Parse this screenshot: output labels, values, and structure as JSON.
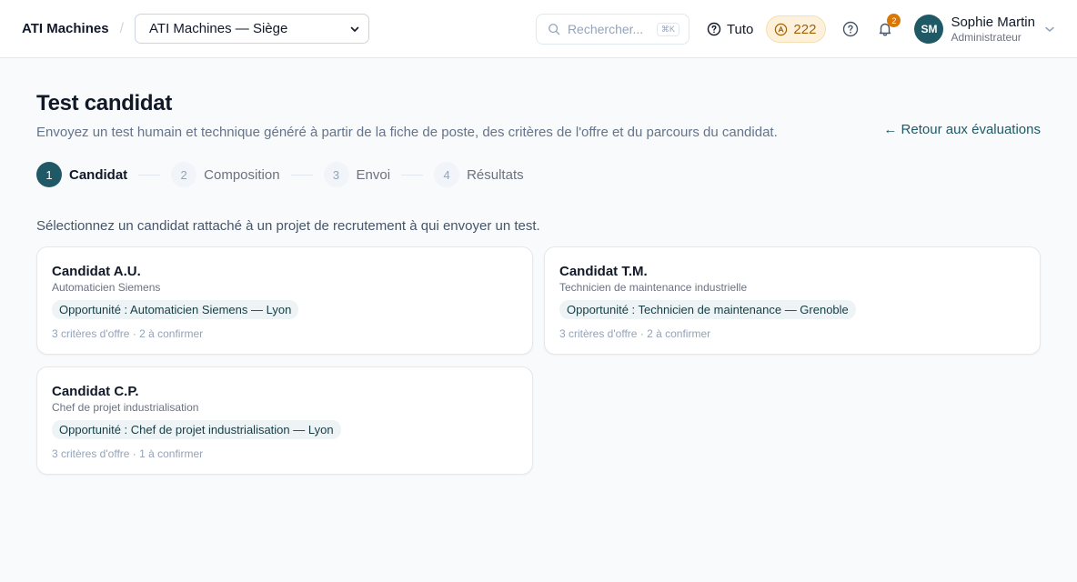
{
  "header": {
    "brand": "ATI Machines",
    "separator": "/",
    "org_select": "ATI Machines — Siège",
    "search_placeholder": "Rechercher...",
    "search_shortcut": "⌘K",
    "tuto_label": "Tuto",
    "credits": "222",
    "notifications_count": "2",
    "user": {
      "initials": "SM",
      "name": "Sophie Martin",
      "role": "Administrateur"
    }
  },
  "page": {
    "title": "Test candidat",
    "subtitle": "Envoyez un test humain et technique généré à partir de la fiche de poste, des critères de l'offre et du parcours du candidat.",
    "back_link": "← Retour aux évaluations"
  },
  "steps": [
    {
      "num": "1",
      "label": "Candidat"
    },
    {
      "num": "2",
      "label": "Composition"
    },
    {
      "num": "3",
      "label": "Envoi"
    },
    {
      "num": "4",
      "label": "Résultats"
    }
  ],
  "active_step": "1",
  "instruction": "Sélectionnez un candidat rattaché à un projet de recrutement à qui envoyer un test.",
  "candidates": [
    {
      "name": "Candidat A.U.",
      "role": "Automaticien Siemens",
      "opportunity": "Opportunité : Automaticien Siemens — Lyon",
      "meta": "3 critères d'offre · 2 à confirmer"
    },
    {
      "name": "Candidat T.M.",
      "role": "Technicien de maintenance industrielle",
      "opportunity": "Opportunité : Technicien de maintenance — Grenoble",
      "meta": "3 critères d'offre · 2 à confirmer"
    },
    {
      "name": "Candidat C.P.",
      "role": "Chef de projet industrialisation",
      "opportunity": "Opportunité : Chef de projet industrialisation — Lyon",
      "meta": "3 critères d'offre · 1 à confirmer"
    }
  ],
  "colors": {
    "accent": "#1f5965",
    "credits_bg": "#fdf1dc",
    "credits_text": "#a16207",
    "badge": "#d97706"
  },
  "icons": [
    "chevron-down-icon",
    "search-icon",
    "help-circle-icon",
    "coin-icon",
    "question-icon",
    "bell-icon"
  ]
}
